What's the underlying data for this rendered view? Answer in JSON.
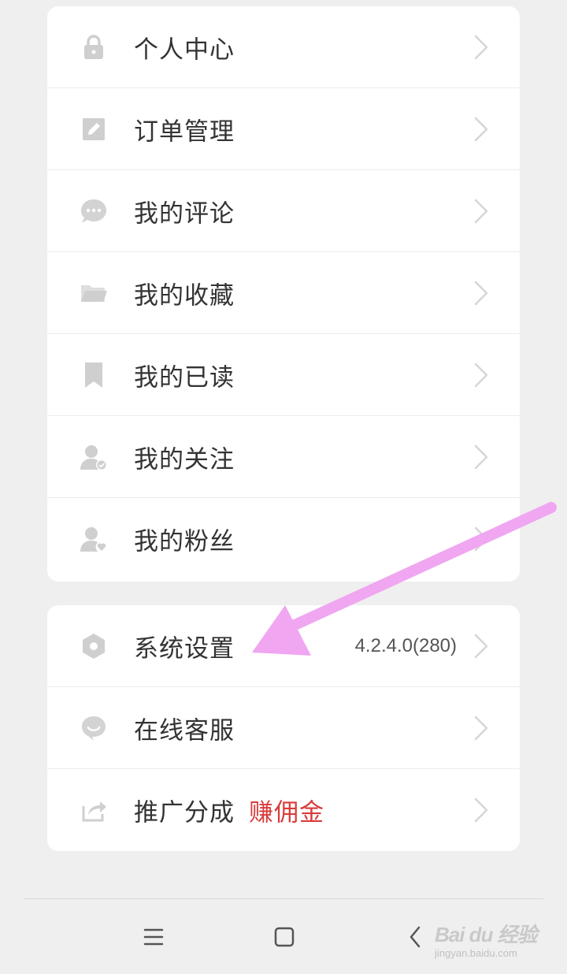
{
  "menu_group_1": {
    "items": [
      {
        "label": "个人中心",
        "icon": "lock-icon"
      },
      {
        "label": "订单管理",
        "icon": "edit-icon"
      },
      {
        "label": "我的评论",
        "icon": "comment-bubble-icon"
      },
      {
        "label": "我的收藏",
        "icon": "folder-icon"
      },
      {
        "label": "我的已读",
        "icon": "bookmark-icon"
      },
      {
        "label": "我的关注",
        "icon": "user-check-icon"
      },
      {
        "label": "我的粉丝",
        "icon": "user-heart-icon"
      }
    ]
  },
  "menu_group_2": {
    "items": [
      {
        "label": "系统设置",
        "icon": "hexagon-settings-icon",
        "value": "4.2.4.0(280)"
      },
      {
        "label": "在线客服",
        "icon": "chat-smile-icon"
      },
      {
        "label": "推广分成",
        "icon": "share-icon",
        "accent": "赚佣金"
      }
    ]
  },
  "navigation": {
    "menu_icon": "menu-icon",
    "home_icon": "home-square-icon",
    "back_icon": "back-chevron-icon"
  },
  "watermark": {
    "main": "Bai du 经验",
    "sub": "jingyan.baidu.com"
  },
  "colors": {
    "background": "#efefef",
    "card": "#ffffff",
    "text": "#333333",
    "icon": "#cfcfcf",
    "accent": "#d83b3b",
    "annotation_arrow": "#f0a6f0"
  }
}
